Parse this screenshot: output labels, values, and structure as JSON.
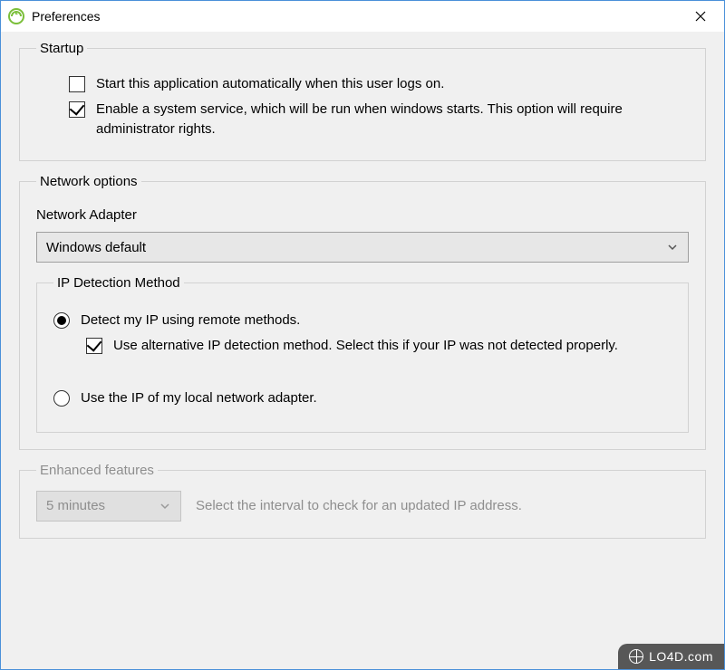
{
  "window": {
    "title": "Preferences"
  },
  "startup": {
    "legend": "Startup",
    "autostart": {
      "checked": false,
      "label": "Start this application automatically when this user logs on."
    },
    "service": {
      "checked": true,
      "label": "Enable a system service, which will be run when windows starts. This option will require administrator rights."
    }
  },
  "network": {
    "legend": "Network options",
    "adapter_label": "Network Adapter",
    "adapter_value": "Windows default",
    "ip_detection": {
      "legend": "IP Detection Method",
      "remote": {
        "selected": true,
        "label": "Detect my IP using remote methods."
      },
      "alt_method": {
        "checked": true,
        "label": "Use alternative IP detection method. Select this if your IP was not detected properly."
      },
      "local": {
        "selected": false,
        "label": "Use the IP of my local network adapter."
      }
    }
  },
  "enhanced": {
    "legend": "Enhanced features",
    "interval_value": "5 minutes",
    "helper": "Select the interval to check for an updated IP address.",
    "enabled": false
  },
  "watermark": "LO4D.com"
}
